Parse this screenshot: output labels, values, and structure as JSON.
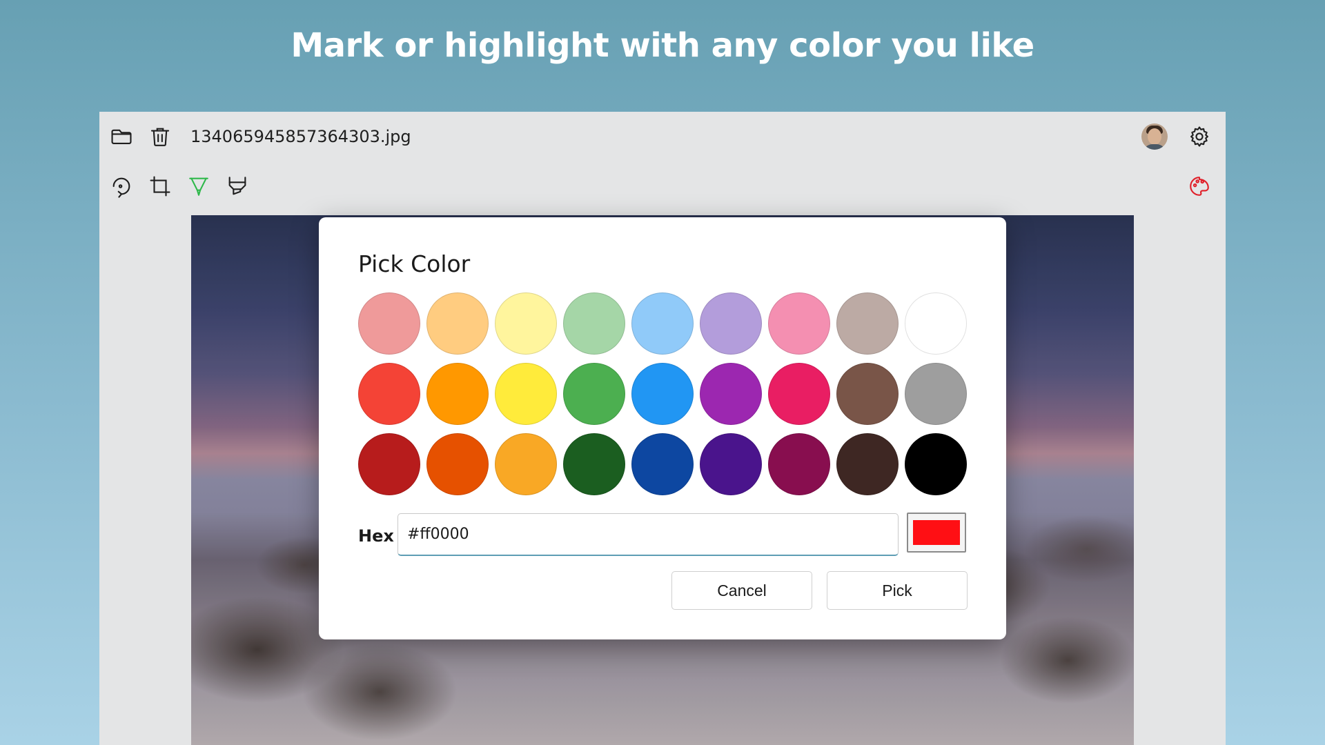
{
  "headline": "Mark or highlight with any color you like",
  "file": {
    "name": "134065945857364303.jpg"
  },
  "icons": {
    "open_folder": "folder-icon",
    "delete": "trash-icon",
    "rotate": "rotate-icon",
    "crop": "crop-icon",
    "marker": "marker-icon",
    "highlighter": "highlighter-icon",
    "avatar": "avatar",
    "settings": "gear-icon",
    "palette": "palette-icon"
  },
  "accent_colors": {
    "marker": "#2eb84a",
    "palette": "#e0202a"
  },
  "dialog": {
    "title": "Pick Color",
    "swatches": [
      [
        "#ef9a9a",
        "#ffcc80",
        "#fff59d",
        "#a5d6a7",
        "#90caf9",
        "#b39ddb",
        "#f48fb1",
        "#bcaaa4",
        "#ffffff"
      ],
      [
        "#f44336",
        "#ff9800",
        "#ffeb3b",
        "#4caf50",
        "#2196f3",
        "#9c27b0",
        "#e91e63",
        "#795548",
        "#9e9e9e"
      ],
      [
        "#b71c1c",
        "#e65100",
        "#f9a825",
        "#1b5e20",
        "#0d47a1",
        "#4a148c",
        "#880e4f",
        "#3e2723",
        "#000000"
      ]
    ],
    "hex_label": "Hex",
    "hex_value": "#ff0000",
    "preview_color": "#ff0f14",
    "cancel_label": "Cancel",
    "pick_label": "Pick"
  }
}
